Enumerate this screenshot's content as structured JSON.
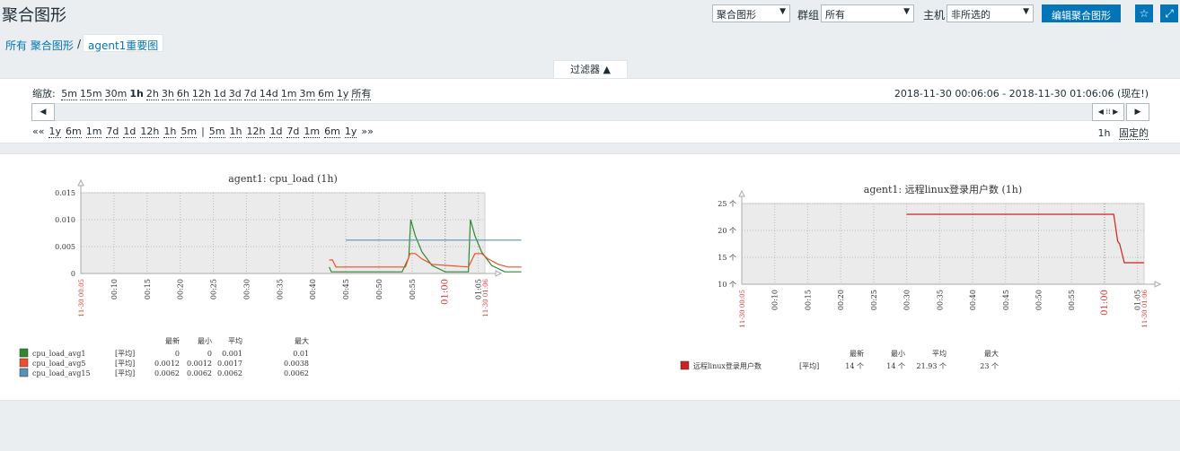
{
  "header": {
    "title": "聚合图形",
    "screen_select": "聚合图形",
    "group_label": "群组",
    "group_select": "所有",
    "host_label": "主机",
    "host_select": "非所选的",
    "edit_button": "编辑聚合图形",
    "favorite_icon": "star-icon",
    "fullscreen_icon": "expand-icon"
  },
  "breadcrumb": {
    "all": "所有 聚合图形",
    "separator": "/",
    "current": "agent1重要图"
  },
  "filter": {
    "tab_label": "过滤器 ▲",
    "zoom_label": "缩放:",
    "zoom_options": [
      "5m",
      "15m",
      "30m",
      "1h",
      "2h",
      "3h",
      "6h",
      "12h",
      "1d",
      "3d",
      "7d",
      "14d",
      "1m",
      "3m",
      "6m",
      "1y",
      "所有"
    ],
    "zoom_active": "1h",
    "time_range": "2018-11-30 00:06:06 - 2018-11-30 01:06:06 (现在!)",
    "nav_back": "««",
    "nav_back_options": [
      "1y",
      "6m",
      "1m",
      "7d",
      "1d",
      "12h",
      "1h",
      "5m"
    ],
    "nav_divider": "|",
    "nav_fwd_options": [
      "5m",
      "1h",
      "12h",
      "1d",
      "7d",
      "1m",
      "6m",
      "1y"
    ],
    "nav_fwd": "»»",
    "period": "1h",
    "fixed": "固定的"
  },
  "chart_data": [
    {
      "type": "line",
      "title": "agent1: cpu_load (1h)",
      "ylim": [
        0,
        0.015
      ],
      "y_ticks": [
        "0.015",
        "0.010",
        "0.005",
        "0"
      ],
      "x_ticks": [
        "00:10",
        "00:15",
        "00:20",
        "00:25",
        "00:30",
        "00:35",
        "00:40",
        "00:45",
        "00:50",
        "00:55",
        "01:00",
        "01:05"
      ],
      "x_start_label": "11-30 00:05",
      "x_end_label": "11-30 01:06",
      "grid": true,
      "x_range_minutes": [
        0,
        60
      ],
      "series": [
        {
          "name": "cpu_load_avg1",
          "color": "#2d8a2d",
          "x": [
            37.5,
            37.8,
            48.5,
            49.5,
            49.8,
            50.5,
            51.5,
            53,
            55,
            58.5,
            58.8,
            59.5,
            60.5,
            62,
            64,
            65.5,
            66.5
          ],
          "y": [
            0.0012,
            0.0003,
            0.0003,
            0.003,
            0.01,
            0.007,
            0.004,
            0.0015,
            0.0003,
            0.0003,
            0.01,
            0.007,
            0.004,
            0.0015,
            0.0003,
            0.0003,
            0.0003
          ]
        },
        {
          "name": "cpu_load_avg5",
          "color": "#ee4e2c",
          "x": [
            37.5,
            38,
            38.5,
            49,
            49.7,
            50.5,
            51.5,
            53,
            58.5,
            59.5,
            60.5,
            61.5,
            63,
            64.5,
            66.5
          ],
          "y": [
            0.0025,
            0.0025,
            0.0012,
            0.0012,
            0.0037,
            0.0037,
            0.0027,
            0.0017,
            0.0012,
            0.0037,
            0.0037,
            0.0027,
            0.0017,
            0.0012,
            0.0012
          ]
        },
        {
          "name": "cpu_load_avg15",
          "color": "#5a8fb7",
          "x": [
            40,
            66.5
          ],
          "y": [
            0.0062,
            0.0062
          ]
        }
      ],
      "legend": {
        "headers": [
          "最新",
          "最小",
          "平均",
          "最大"
        ],
        "rows": [
          {
            "name": "cpu_load_avg1",
            "func": "[平均]",
            "last": "0",
            "min": "0",
            "avg": "0.001",
            "max": "0.01",
            "color": "#2d8a2d"
          },
          {
            "name": "cpu_load_avg5",
            "func": "[平均]",
            "last": "0.0012",
            "min": "0.0012",
            "avg": "0.0017",
            "max": "0.0038",
            "color": "#ee4e2c"
          },
          {
            "name": "cpu_load_avg15",
            "func": "[平均]",
            "last": "0.0062",
            "min": "0.0062",
            "avg": "0.0062",
            "max": "0.0062",
            "color": "#5a8fb7"
          }
        ]
      }
    },
    {
      "type": "line",
      "title": "agent1: 远程linux登录用户数 (1h)",
      "ylim": [
        10,
        25
      ],
      "y_ticks": [
        "25 个",
        "20 个",
        "15 个",
        "10 个"
      ],
      "x_ticks": [
        "00:10",
        "00:15",
        "00:20",
        "00:25",
        "00:30",
        "00:35",
        "00:40",
        "00:45",
        "00:50",
        "00:55",
        "01:00",
        "01:05"
      ],
      "x_start_label": "11-30 00:05",
      "x_end_label": "11-30 01:06",
      "grid": true,
      "x_range_minutes": [
        0,
        60
      ],
      "series": [
        {
          "name": "远程linux登录用户数",
          "color": "#cc2222",
          "x": [
            25,
            56.4,
            57,
            57.3,
            58,
            61
          ],
          "y": [
            23,
            23,
            18,
            17.5,
            14,
            14
          ]
        }
      ],
      "legend": {
        "headers": [
          "最新",
          "最小",
          "平均",
          "最大"
        ],
        "rows": [
          {
            "name": "远程linux登录用户数",
            "func": "[平均]",
            "last": "14 个",
            "min": "14 个",
            "avg": "21.93 个",
            "max": "23 个",
            "color": "#cc2222"
          }
        ]
      }
    }
  ]
}
